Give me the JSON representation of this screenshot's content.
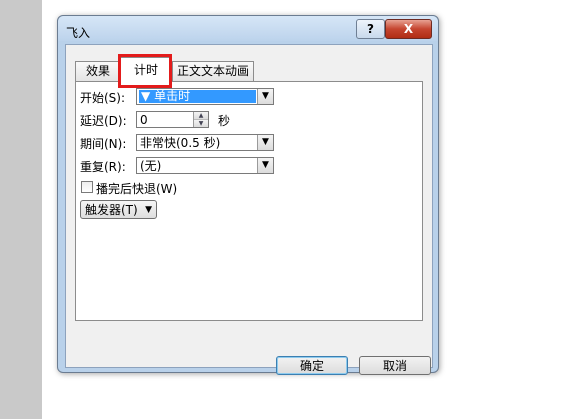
{
  "dialog": {
    "title": "飞入",
    "help_label": "?",
    "close_label": "X"
  },
  "tabs": [
    {
      "label": "效果"
    },
    {
      "label": "计时"
    },
    {
      "label": "正文文本动画"
    }
  ],
  "timing": {
    "start_label": "开始(S):",
    "start_value": "单击时",
    "delay_label": "延迟(D):",
    "delay_value": "0",
    "delay_unit": "秒",
    "duration_label": "期间(N):",
    "duration_value": "非常快(0.5 秒)",
    "repeat_label": "重复(R):",
    "repeat_value": "(无)",
    "rewind_label": "播完后快退(W)",
    "rewind_checked": false,
    "triggers_label": "触发器(T)"
  },
  "buttons": {
    "ok": "确定",
    "cancel": "取消"
  },
  "colors": {
    "highlight": "#e31b1b",
    "selection": "#3399ff"
  }
}
